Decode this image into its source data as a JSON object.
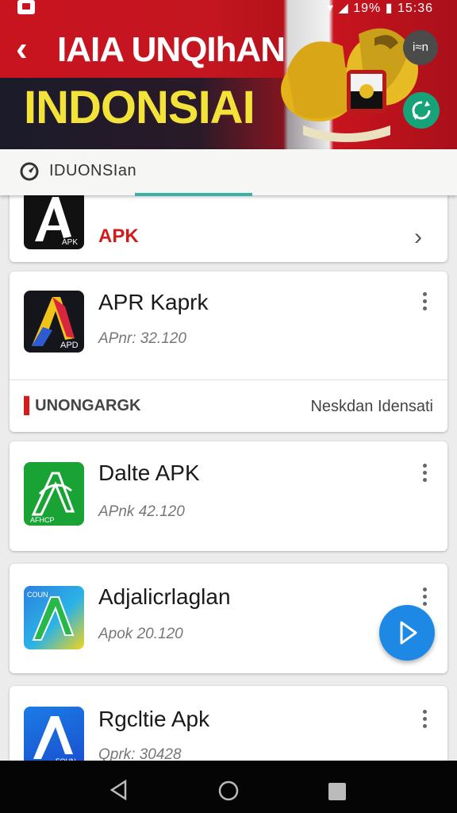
{
  "status_bar": {
    "battery": "19%",
    "time": "15:36"
  },
  "header": {
    "back_icon": "back-arrow-icon",
    "title": "IAIA UNQIhAN",
    "subtitle": "INDONSIAI",
    "lang_button_label": "i≈n",
    "refresh_icon": "refresh-icon",
    "colors": {
      "red": "#c8141f",
      "yellow": "#f2e23a",
      "dark": "#1b1b2a",
      "green": "#17a37a"
    }
  },
  "search": {
    "text": "IDUONSIan",
    "icon": "search-icon"
  },
  "partial_card": {
    "label": "APK",
    "chevron_icon": "chevron-right-icon"
  },
  "apps": [
    {
      "name": "APR Kaprk",
      "sub": "APnr: 32.120",
      "icon_text": "APD"
    },
    {
      "name": "Dalte APK",
      "sub": "APnk 42.120",
      "icon_text": "AFHCP"
    },
    {
      "name": "Adjalicrlaglan",
      "sub": "Apok 20.120",
      "icon_text": "COUN"
    },
    {
      "name": "Rgcltie Apk",
      "sub": "Qprk: 30428",
      "icon_text": "FOUN"
    }
  ],
  "section": {
    "left": "UNONGARGK",
    "right": "Neskdan Idensati"
  },
  "fab_icon": "play-icon",
  "nav": {
    "back": "nav-back-icon",
    "home": "nav-home-icon",
    "recents": "nav-recents-icon"
  }
}
